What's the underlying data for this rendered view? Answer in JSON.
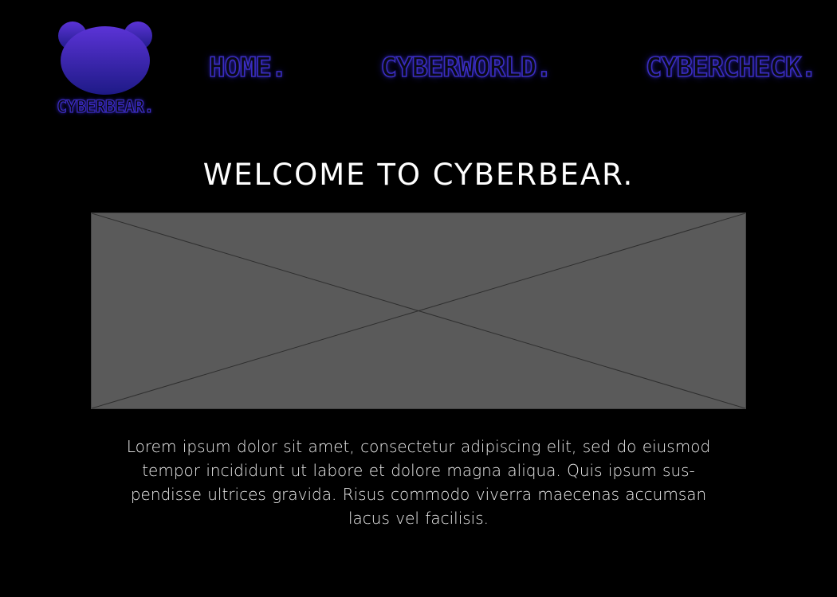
{
  "brand": {
    "logo_text": "CYBERBEAR.",
    "logo_icon": "bear-head-icon",
    "accent_color": "#3a2dc0",
    "logo_gradient_top": "#5b33d6",
    "logo_gradient_bottom": "#1e1a86"
  },
  "nav": {
    "items": [
      {
        "label": "HOME."
      },
      {
        "label": "CYBERWORLD."
      },
      {
        "label": "CYBERCHECK."
      }
    ]
  },
  "main": {
    "title": "WELCOME TO CYBERBEAR.",
    "image_placeholder": "image-placeholder",
    "body_lines": [
      "Lorem ipsum dolor sit amet, consectetur adipiscing elit, sed do eiusmod",
      "tempor incididunt ut labore et dolore magna aliqua. Quis ipsum sus-",
      "pendisse ultrices gravida. Risus commodo viverra maecenas accumsan",
      "lacus vel facilisis."
    ]
  },
  "colors": {
    "background": "#000000",
    "placeholder_fill": "#5a5a5a",
    "text": "#ffffff"
  }
}
